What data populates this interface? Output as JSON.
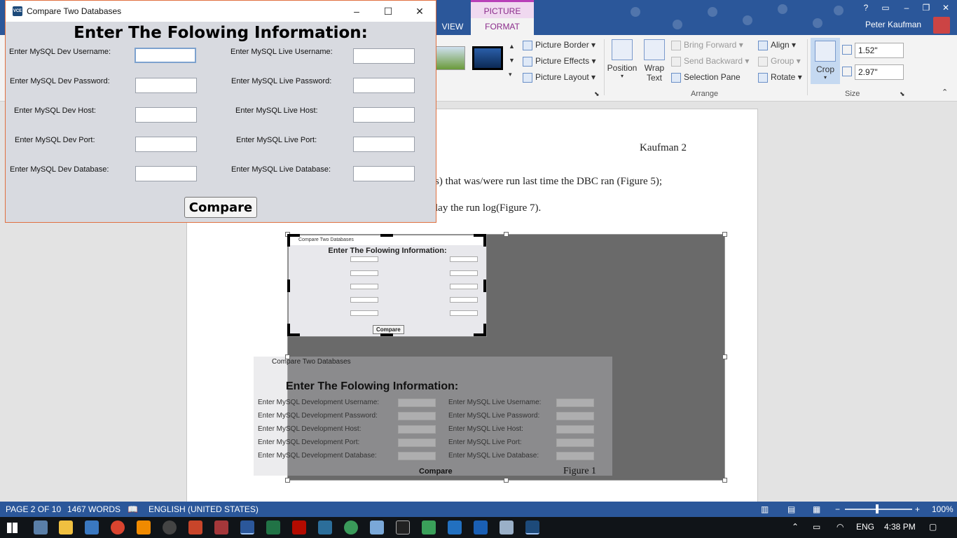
{
  "word": {
    "picture_tools_label": "PICTURE TOOLS",
    "tabs": {
      "view": "VIEW",
      "format": "FORMAT"
    },
    "user_name": "Peter Kaufman",
    "ribbon": {
      "picture_border": "Picture Border",
      "picture_effects": "Picture Effects",
      "picture_layout": "Picture Layout",
      "position": "Position",
      "wrap_text": "Wrap Text",
      "bring_forward": "Bring Forward",
      "send_backward": "Send Backward",
      "selection_pane": "Selection Pane",
      "align": "Align",
      "group": "Group",
      "rotate": "Rotate",
      "crop": "Crop",
      "height_value": "1.52\"",
      "width_value": "2.97\"",
      "arrange_label": "Arrange",
      "size_label": "Size"
    },
    "document": {
      "header_right": "Kaufman 2",
      "line1": "s) that was/were run last time the DBC ran (Figure  5);",
      "line2": "lay the run log(Figure 7).",
      "figure_caption": "Figure 1",
      "figure_inner_title": "Compare Two Databases",
      "figure_inner_heading": "Enter The Folowing Information:",
      "figure_inner_compare": "Compare",
      "figure_bg_title": "Compare Two Databases",
      "figure_bg_heading": "Enter The Folowing Information:",
      "figure_bg_compare": "Compare",
      "figure_bg_rows_left": [
        "Enter MySQL Development Username:",
        "Enter MySQL Development Password:",
        "Enter MySQL Development Host:",
        "Enter MySQL Development Port:",
        "Enter MySQL Development Database:"
      ],
      "figure_bg_rows_right": [
        "Enter MySQL Live Username:",
        "Enter MySQL  Live Password:",
        "Enter MySQL  Live Host:",
        "Enter MySQL  Live Port:",
        "Enter MySQL  Live Database:"
      ]
    },
    "status": {
      "page": "PAGE 2 OF 10",
      "words": "1467 WORDS",
      "language": "ENGLISH (UNITED STATES)",
      "zoom": "100%"
    }
  },
  "taskbar": {
    "language": "ENG",
    "time": "4:38 PM"
  },
  "dialog": {
    "title": "Compare Two Databases",
    "app_icon_text": "VCE",
    "heading": "Enter The Folowing Information:",
    "fields_left": [
      {
        "label": "Enter MySQL Dev Username:",
        "value": ""
      },
      {
        "label": "Enter MySQL Dev Password:",
        "value": ""
      },
      {
        "label": "Enter MySQL Dev Host:",
        "value": ""
      },
      {
        "label": "Enter MySQL Dev Port:",
        "value": ""
      },
      {
        "label": "Enter MySQL Dev Database:",
        "value": ""
      }
    ],
    "fields_right": [
      {
        "label": "Enter MySQL Live Username:",
        "value": ""
      },
      {
        "label": "Enter MySQL Live Password:",
        "value": ""
      },
      {
        "label": "Enter MySQL Live Host:",
        "value": ""
      },
      {
        "label": "Enter MySQL Live Port:",
        "value": ""
      },
      {
        "label": "Enter MySQL Live Database:",
        "value": ""
      }
    ],
    "compare_label": "Compare"
  }
}
